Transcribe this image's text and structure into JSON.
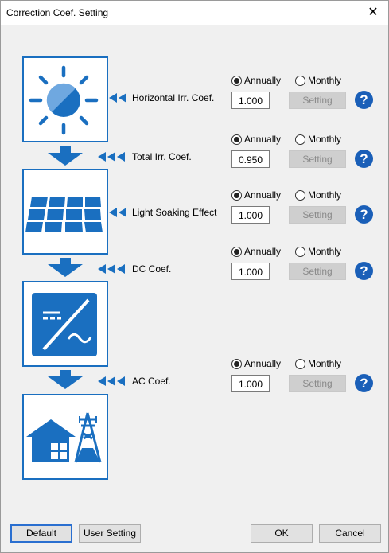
{
  "window": {
    "title": "Correction Coef. Setting"
  },
  "rows": [
    {
      "label": "Horizontal Irr. Coef.",
      "annually": "Annually",
      "monthly": "Monthly",
      "value": "1.000",
      "setting": "Setting",
      "mode": "annually",
      "arrows": 2
    },
    {
      "label": "Total Irr. Coef.",
      "annually": "Annually",
      "monthly": "Monthly",
      "value": "0.950",
      "setting": "Setting",
      "mode": "annually",
      "arrows": 3
    },
    {
      "label": "Light Soaking Effect",
      "annually": "Annually",
      "monthly": "Monthly",
      "value": "1.000",
      "setting": "Setting",
      "mode": "annually",
      "arrows": 2
    },
    {
      "label": "DC Coef.",
      "annually": "Annually",
      "monthly": "Monthly",
      "value": "1.000",
      "setting": "Setting",
      "mode": "annually",
      "arrows": 3
    },
    {
      "label": "AC Coef.",
      "annually": "Annually",
      "monthly": "Monthly",
      "value": "1.000",
      "setting": "Setting",
      "mode": "annually",
      "arrows": 3
    }
  ],
  "help_glyph": "?",
  "buttons": {
    "default": "Default",
    "user_setting": "User Setting",
    "ok": "OK",
    "cancel": "Cancel"
  },
  "icons": [
    "sun-icon",
    "solar-panel-icon",
    "inverter-icon",
    "house-grid-icon"
  ],
  "colors": {
    "accent": "#1a6fc0",
    "help": "#1a5fb8",
    "disabled_button": "#cfcfcf"
  }
}
